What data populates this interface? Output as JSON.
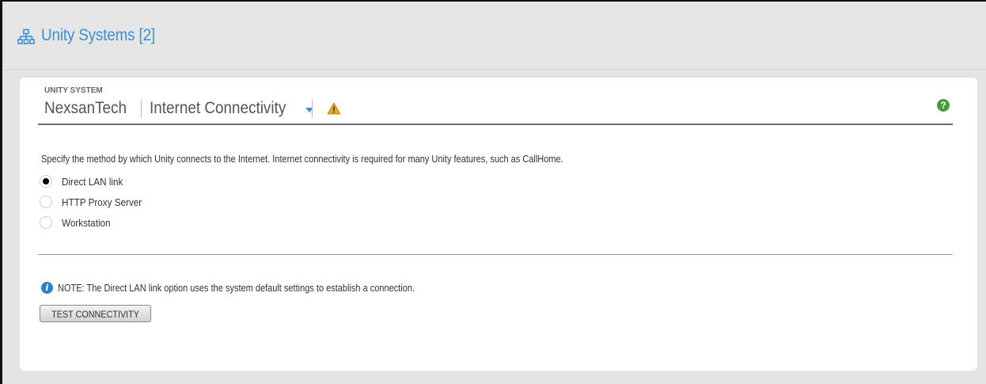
{
  "topbar": {
    "icon": "network-icon",
    "title": "Unity Systems [2]"
  },
  "card": {
    "kicker": "UNITY SYSTEM",
    "system_name": "NexsanTech",
    "section": "Internet Connectivity",
    "warning_icon": "warning-icon",
    "help_icon": "help-icon",
    "help_glyph": "?",
    "description": "Specify the method by which Unity connects to the Internet. Internet connectivity is required for many Unity features, such as CallHome.",
    "options": [
      {
        "label": "Direct LAN link",
        "selected": true
      },
      {
        "label": "HTTP Proxy Server",
        "selected": false
      },
      {
        "label": "Workstation",
        "selected": false
      }
    ],
    "note_icon": "info-icon",
    "note_glyph": "i",
    "note": "NOTE: The Direct LAN link option uses the system default settings to establish a connection.",
    "test_button": "TEST CONNECTIVITY"
  },
  "colors": {
    "accent": "#3d8fd6",
    "help": "#4a9b3a",
    "warning": "#e8a417",
    "info": "#2c7fc7"
  }
}
